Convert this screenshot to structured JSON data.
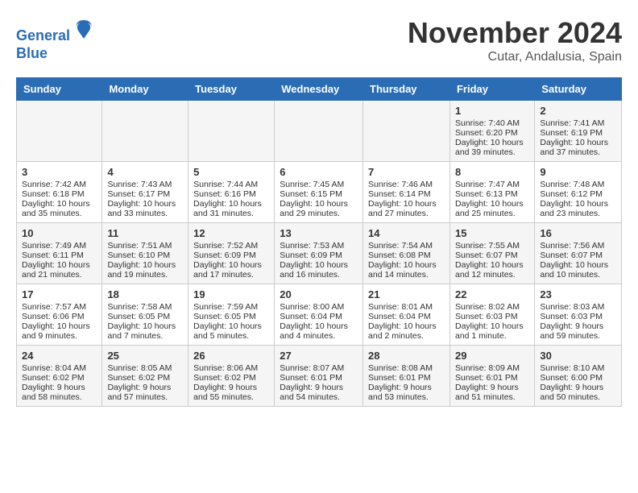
{
  "header": {
    "logo_line1": "General",
    "logo_line2": "Blue",
    "month_title": "November 2024",
    "location": "Cutar, Andalusia, Spain"
  },
  "days_of_week": [
    "Sunday",
    "Monday",
    "Tuesday",
    "Wednesday",
    "Thursday",
    "Friday",
    "Saturday"
  ],
  "weeks": [
    [
      {
        "day": "",
        "content": ""
      },
      {
        "day": "",
        "content": ""
      },
      {
        "day": "",
        "content": ""
      },
      {
        "day": "",
        "content": ""
      },
      {
        "day": "",
        "content": ""
      },
      {
        "day": "1",
        "content": "Sunrise: 7:40 AM\nSunset: 6:20 PM\nDaylight: 10 hours and 39 minutes."
      },
      {
        "day": "2",
        "content": "Sunrise: 7:41 AM\nSunset: 6:19 PM\nDaylight: 10 hours and 37 minutes."
      }
    ],
    [
      {
        "day": "3",
        "content": "Sunrise: 7:42 AM\nSunset: 6:18 PM\nDaylight: 10 hours and 35 minutes."
      },
      {
        "day": "4",
        "content": "Sunrise: 7:43 AM\nSunset: 6:17 PM\nDaylight: 10 hours and 33 minutes."
      },
      {
        "day": "5",
        "content": "Sunrise: 7:44 AM\nSunset: 6:16 PM\nDaylight: 10 hours and 31 minutes."
      },
      {
        "day": "6",
        "content": "Sunrise: 7:45 AM\nSunset: 6:15 PM\nDaylight: 10 hours and 29 minutes."
      },
      {
        "day": "7",
        "content": "Sunrise: 7:46 AM\nSunset: 6:14 PM\nDaylight: 10 hours and 27 minutes."
      },
      {
        "day": "8",
        "content": "Sunrise: 7:47 AM\nSunset: 6:13 PM\nDaylight: 10 hours and 25 minutes."
      },
      {
        "day": "9",
        "content": "Sunrise: 7:48 AM\nSunset: 6:12 PM\nDaylight: 10 hours and 23 minutes."
      }
    ],
    [
      {
        "day": "10",
        "content": "Sunrise: 7:49 AM\nSunset: 6:11 PM\nDaylight: 10 hours and 21 minutes."
      },
      {
        "day": "11",
        "content": "Sunrise: 7:51 AM\nSunset: 6:10 PM\nDaylight: 10 hours and 19 minutes."
      },
      {
        "day": "12",
        "content": "Sunrise: 7:52 AM\nSunset: 6:09 PM\nDaylight: 10 hours and 17 minutes."
      },
      {
        "day": "13",
        "content": "Sunrise: 7:53 AM\nSunset: 6:09 PM\nDaylight: 10 hours and 16 minutes."
      },
      {
        "day": "14",
        "content": "Sunrise: 7:54 AM\nSunset: 6:08 PM\nDaylight: 10 hours and 14 minutes."
      },
      {
        "day": "15",
        "content": "Sunrise: 7:55 AM\nSunset: 6:07 PM\nDaylight: 10 hours and 12 minutes."
      },
      {
        "day": "16",
        "content": "Sunrise: 7:56 AM\nSunset: 6:07 PM\nDaylight: 10 hours and 10 minutes."
      }
    ],
    [
      {
        "day": "17",
        "content": "Sunrise: 7:57 AM\nSunset: 6:06 PM\nDaylight: 10 hours and 9 minutes."
      },
      {
        "day": "18",
        "content": "Sunrise: 7:58 AM\nSunset: 6:05 PM\nDaylight: 10 hours and 7 minutes."
      },
      {
        "day": "19",
        "content": "Sunrise: 7:59 AM\nSunset: 6:05 PM\nDaylight: 10 hours and 5 minutes."
      },
      {
        "day": "20",
        "content": "Sunrise: 8:00 AM\nSunset: 6:04 PM\nDaylight: 10 hours and 4 minutes."
      },
      {
        "day": "21",
        "content": "Sunrise: 8:01 AM\nSunset: 6:04 PM\nDaylight: 10 hours and 2 minutes."
      },
      {
        "day": "22",
        "content": "Sunrise: 8:02 AM\nSunset: 6:03 PM\nDaylight: 10 hours and 1 minute."
      },
      {
        "day": "23",
        "content": "Sunrise: 8:03 AM\nSunset: 6:03 PM\nDaylight: 9 hours and 59 minutes."
      }
    ],
    [
      {
        "day": "24",
        "content": "Sunrise: 8:04 AM\nSunset: 6:02 PM\nDaylight: 9 hours and 58 minutes."
      },
      {
        "day": "25",
        "content": "Sunrise: 8:05 AM\nSunset: 6:02 PM\nDaylight: 9 hours and 57 minutes."
      },
      {
        "day": "26",
        "content": "Sunrise: 8:06 AM\nSunset: 6:02 PM\nDaylight: 9 hours and 55 minutes."
      },
      {
        "day": "27",
        "content": "Sunrise: 8:07 AM\nSunset: 6:01 PM\nDaylight: 9 hours and 54 minutes."
      },
      {
        "day": "28",
        "content": "Sunrise: 8:08 AM\nSunset: 6:01 PM\nDaylight: 9 hours and 53 minutes."
      },
      {
        "day": "29",
        "content": "Sunrise: 8:09 AM\nSunset: 6:01 PM\nDaylight: 9 hours and 51 minutes."
      },
      {
        "day": "30",
        "content": "Sunrise: 8:10 AM\nSunset: 6:00 PM\nDaylight: 9 hours and 50 minutes."
      }
    ]
  ]
}
